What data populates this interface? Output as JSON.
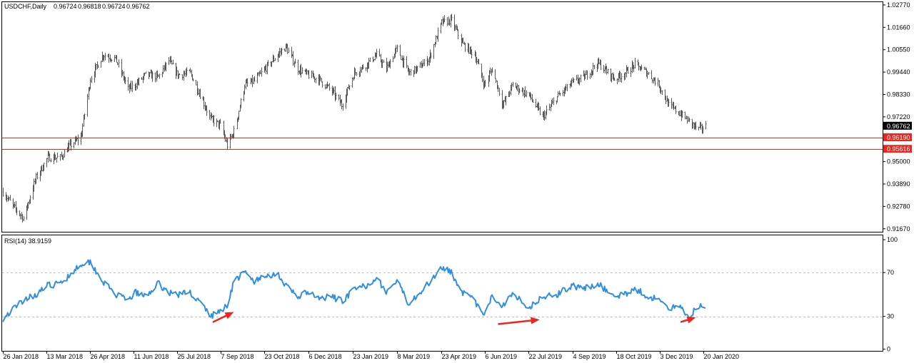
{
  "colors": {
    "background": "#ffffff",
    "bars": "#5a5a5a",
    "rsi_line": "#2f8fe0",
    "support_lines": "#e8281e",
    "price_tag_current": "#000000",
    "price_tag_support": "#e8281e",
    "annotation_arrows": "#e8281e",
    "level_lines": "#c0c0c0"
  },
  "chart_data": [
    {
      "type": "ohlc",
      "title": "USDCHF,Daily",
      "ohlc_header": [
        "0.96724",
        "0.96818",
        "0.96724",
        "0.96762"
      ],
      "symbol": "USDCHF",
      "timeframe": "Daily",
      "last_price": "0.96762",
      "ylim": [
        0.9152,
        1.0291
      ],
      "y_ticks": [
        "1.02770",
        "1.01660",
        "1.00550",
        "0.99440",
        "0.98330",
        "0.97220",
        "0.96110",
        "0.95000",
        "0.93890",
        "0.92780",
        "0.91670"
      ],
      "x_ticks": [
        "26 Jan 2018",
        "13 Mar 2018",
        "26 Apr 2018",
        "11 Jun 2018",
        "25 Jul 2018",
        "7 Sep 2018",
        "23 Oct 2018",
        "6 Dec 2018",
        "23 Jan 2019",
        "8 Mar 2019",
        "23 Apr 2019",
        "6 Jun 2019",
        "22 Jul 2019",
        "4 Sep 2019",
        "18 Oct 2019",
        "3 Dec 2019",
        "20 Jan 2020"
      ],
      "horizontal_lines": [
        {
          "label": "0.96190",
          "value": 0.9619
        },
        {
          "label": "0.95616",
          "value": 0.95616
        }
      ],
      "series_anchors": [
        {
          "date": "2018-01-26",
          "close": 0.935
        },
        {
          "date": "2018-02-05",
          "close": 0.928
        },
        {
          "date": "2018-02-16",
          "close": 0.922
        },
        {
          "date": "2018-03-01",
          "close": 0.942
        },
        {
          "date": "2018-03-13",
          "close": 0.952
        },
        {
          "date": "2018-03-26",
          "close": 0.952
        },
        {
          "date": "2018-04-05",
          "close": 0.958
        },
        {
          "date": "2018-04-16",
          "close": 0.962
        },
        {
          "date": "2018-04-26",
          "close": 0.991
        },
        {
          "date": "2018-05-09",
          "close": 1.003
        },
        {
          "date": "2018-05-22",
          "close": 1.001
        },
        {
          "date": "2018-06-04",
          "close": 0.986
        },
        {
          "date": "2018-06-11",
          "close": 0.988
        },
        {
          "date": "2018-06-22",
          "close": 0.993
        },
        {
          "date": "2018-07-05",
          "close": 0.992
        },
        {
          "date": "2018-07-16",
          "close": 1.0
        },
        {
          "date": "2018-07-25",
          "close": 0.993
        },
        {
          "date": "2018-08-07",
          "close": 0.994
        },
        {
          "date": "2018-08-20",
          "close": 0.98
        },
        {
          "date": "2018-08-28",
          "close": 0.971
        },
        {
          "date": "2018-09-07",
          "close": 0.968
        },
        {
          "date": "2018-09-14",
          "close": 0.958
        },
        {
          "date": "2018-09-21",
          "close": 0.965
        },
        {
          "date": "2018-10-02",
          "close": 0.988
        },
        {
          "date": "2018-10-12",
          "close": 0.99
        },
        {
          "date": "2018-10-23",
          "close": 0.996
        },
        {
          "date": "2018-11-05",
          "close": 1.003
        },
        {
          "date": "2018-11-13",
          "close": 1.007
        },
        {
          "date": "2018-11-26",
          "close": 0.996
        },
        {
          "date": "2018-12-06",
          "close": 0.993
        },
        {
          "date": "2018-12-17",
          "close": 0.991
        },
        {
          "date": "2018-12-31",
          "close": 0.985
        },
        {
          "date": "2019-01-10",
          "close": 0.978
        },
        {
          "date": "2019-01-23",
          "close": 0.994
        },
        {
          "date": "2019-02-04",
          "close": 0.998
        },
        {
          "date": "2019-02-15",
          "close": 1.003
        },
        {
          "date": "2019-02-25",
          "close": 0.996
        },
        {
          "date": "2019-03-08",
          "close": 1.006
        },
        {
          "date": "2019-03-20",
          "close": 0.994
        },
        {
          "date": "2019-03-29",
          "close": 0.996
        },
        {
          "date": "2019-04-10",
          "close": 1.001
        },
        {
          "date": "2019-04-23",
          "close": 1.019
        },
        {
          "date": "2019-05-03",
          "close": 1.02
        },
        {
          "date": "2019-05-15",
          "close": 1.008
        },
        {
          "date": "2019-05-27",
          "close": 1.003
        },
        {
          "date": "2019-06-06",
          "close": 0.988
        },
        {
          "date": "2019-06-14",
          "close": 0.996
        },
        {
          "date": "2019-06-25",
          "close": 0.978
        },
        {
          "date": "2019-07-05",
          "close": 0.988
        },
        {
          "date": "2019-07-22",
          "close": 0.983
        },
        {
          "date": "2019-08-05",
          "close": 0.972
        },
        {
          "date": "2019-08-20",
          "close": 0.982
        },
        {
          "date": "2019-09-04",
          "close": 0.989
        },
        {
          "date": "2019-09-17",
          "close": 0.992
        },
        {
          "date": "2019-10-01",
          "close": 0.999
        },
        {
          "date": "2019-10-18",
          "close": 0.991
        },
        {
          "date": "2019-10-29",
          "close": 0.994
        },
        {
          "date": "2019-11-08",
          "close": 0.998
        },
        {
          "date": "2019-11-21",
          "close": 0.994
        },
        {
          "date": "2019-12-03",
          "close": 0.988
        },
        {
          "date": "2019-12-13",
          "close": 0.978
        },
        {
          "date": "2019-12-24",
          "close": 0.974
        },
        {
          "date": "2020-01-03",
          "close": 0.97
        },
        {
          "date": "2020-01-13",
          "close": 0.966
        },
        {
          "date": "2020-01-20",
          "close": 0.9676
        }
      ]
    },
    {
      "type": "line",
      "title": "RSI(14) 38.9159",
      "ylim": [
        -1.5,
        104
      ],
      "y_ticks": [
        "100",
        "70",
        "30",
        "0"
      ],
      "level_lines": [
        70,
        30
      ],
      "series_anchors": [
        {
          "date": "2018-01-26",
          "value": 28
        },
        {
          "date": "2018-02-05",
          "value": 36
        },
        {
          "date": "2018-02-16",
          "value": 45
        },
        {
          "date": "2018-03-01",
          "value": 50
        },
        {
          "date": "2018-03-13",
          "value": 58
        },
        {
          "date": "2018-03-26",
          "value": 60
        },
        {
          "date": "2018-04-05",
          "value": 68
        },
        {
          "date": "2018-04-16",
          "value": 78
        },
        {
          "date": "2018-04-26",
          "value": 80
        },
        {
          "date": "2018-05-09",
          "value": 62
        },
        {
          "date": "2018-05-22",
          "value": 50
        },
        {
          "date": "2018-06-04",
          "value": 44
        },
        {
          "date": "2018-06-11",
          "value": 52
        },
        {
          "date": "2018-06-22",
          "value": 48
        },
        {
          "date": "2018-07-05",
          "value": 60
        },
        {
          "date": "2018-07-16",
          "value": 52
        },
        {
          "date": "2018-07-25",
          "value": 50
        },
        {
          "date": "2018-08-07",
          "value": 52
        },
        {
          "date": "2018-08-20",
          "value": 40
        },
        {
          "date": "2018-08-28",
          "value": 30
        },
        {
          "date": "2018-09-07",
          "value": 35
        },
        {
          "date": "2018-09-14",
          "value": 40
        },
        {
          "date": "2018-09-21",
          "value": 62
        },
        {
          "date": "2018-10-02",
          "value": 70
        },
        {
          "date": "2018-10-12",
          "value": 62
        },
        {
          "date": "2018-10-23",
          "value": 66
        },
        {
          "date": "2018-11-05",
          "value": 70
        },
        {
          "date": "2018-11-13",
          "value": 58
        },
        {
          "date": "2018-11-26",
          "value": 48
        },
        {
          "date": "2018-12-06",
          "value": 52
        },
        {
          "date": "2018-12-17",
          "value": 46
        },
        {
          "date": "2018-12-31",
          "value": 48
        },
        {
          "date": "2019-01-10",
          "value": 44
        },
        {
          "date": "2019-01-23",
          "value": 54
        },
        {
          "date": "2019-02-04",
          "value": 58
        },
        {
          "date": "2019-02-15",
          "value": 66
        },
        {
          "date": "2019-02-25",
          "value": 52
        },
        {
          "date": "2019-03-08",
          "value": 62
        },
        {
          "date": "2019-03-20",
          "value": 42
        },
        {
          "date": "2019-03-29",
          "value": 50
        },
        {
          "date": "2019-04-10",
          "value": 60
        },
        {
          "date": "2019-04-23",
          "value": 76
        },
        {
          "date": "2019-05-03",
          "value": 70
        },
        {
          "date": "2019-05-15",
          "value": 52
        },
        {
          "date": "2019-05-27",
          "value": 44
        },
        {
          "date": "2019-06-06",
          "value": 30
        },
        {
          "date": "2019-06-14",
          "value": 48
        },
        {
          "date": "2019-06-25",
          "value": 40
        },
        {
          "date": "2019-07-05",
          "value": 52
        },
        {
          "date": "2019-07-22",
          "value": 38
        },
        {
          "date": "2019-08-05",
          "value": 48
        },
        {
          "date": "2019-08-20",
          "value": 50
        },
        {
          "date": "2019-09-04",
          "value": 58
        },
        {
          "date": "2019-09-17",
          "value": 55
        },
        {
          "date": "2019-10-01",
          "value": 60
        },
        {
          "date": "2019-10-18",
          "value": 48
        },
        {
          "date": "2019-10-29",
          "value": 50
        },
        {
          "date": "2019-11-08",
          "value": 56
        },
        {
          "date": "2019-11-21",
          "value": 48
        },
        {
          "date": "2019-12-03",
          "value": 46
        },
        {
          "date": "2019-12-13",
          "value": 36
        },
        {
          "date": "2019-12-24",
          "value": 40
        },
        {
          "date": "2020-01-03",
          "value": 30
        },
        {
          "date": "2020-01-13",
          "value": 40
        },
        {
          "date": "2020-01-20",
          "value": 38.9
        }
      ],
      "annotation_arrows": [
        {
          "from": {
            "date": "2018-08-31",
            "value": 25
          },
          "to": {
            "date": "2018-09-21",
            "value": 34
          }
        },
        {
          "from": {
            "date": "2019-06-21",
            "value": 23
          },
          "to": {
            "date": "2019-08-02",
            "value": 27
          }
        },
        {
          "from": {
            "date": "2019-12-26",
            "value": 25
          },
          "to": {
            "date": "2020-01-10",
            "value": 29
          }
        }
      ]
    }
  ]
}
